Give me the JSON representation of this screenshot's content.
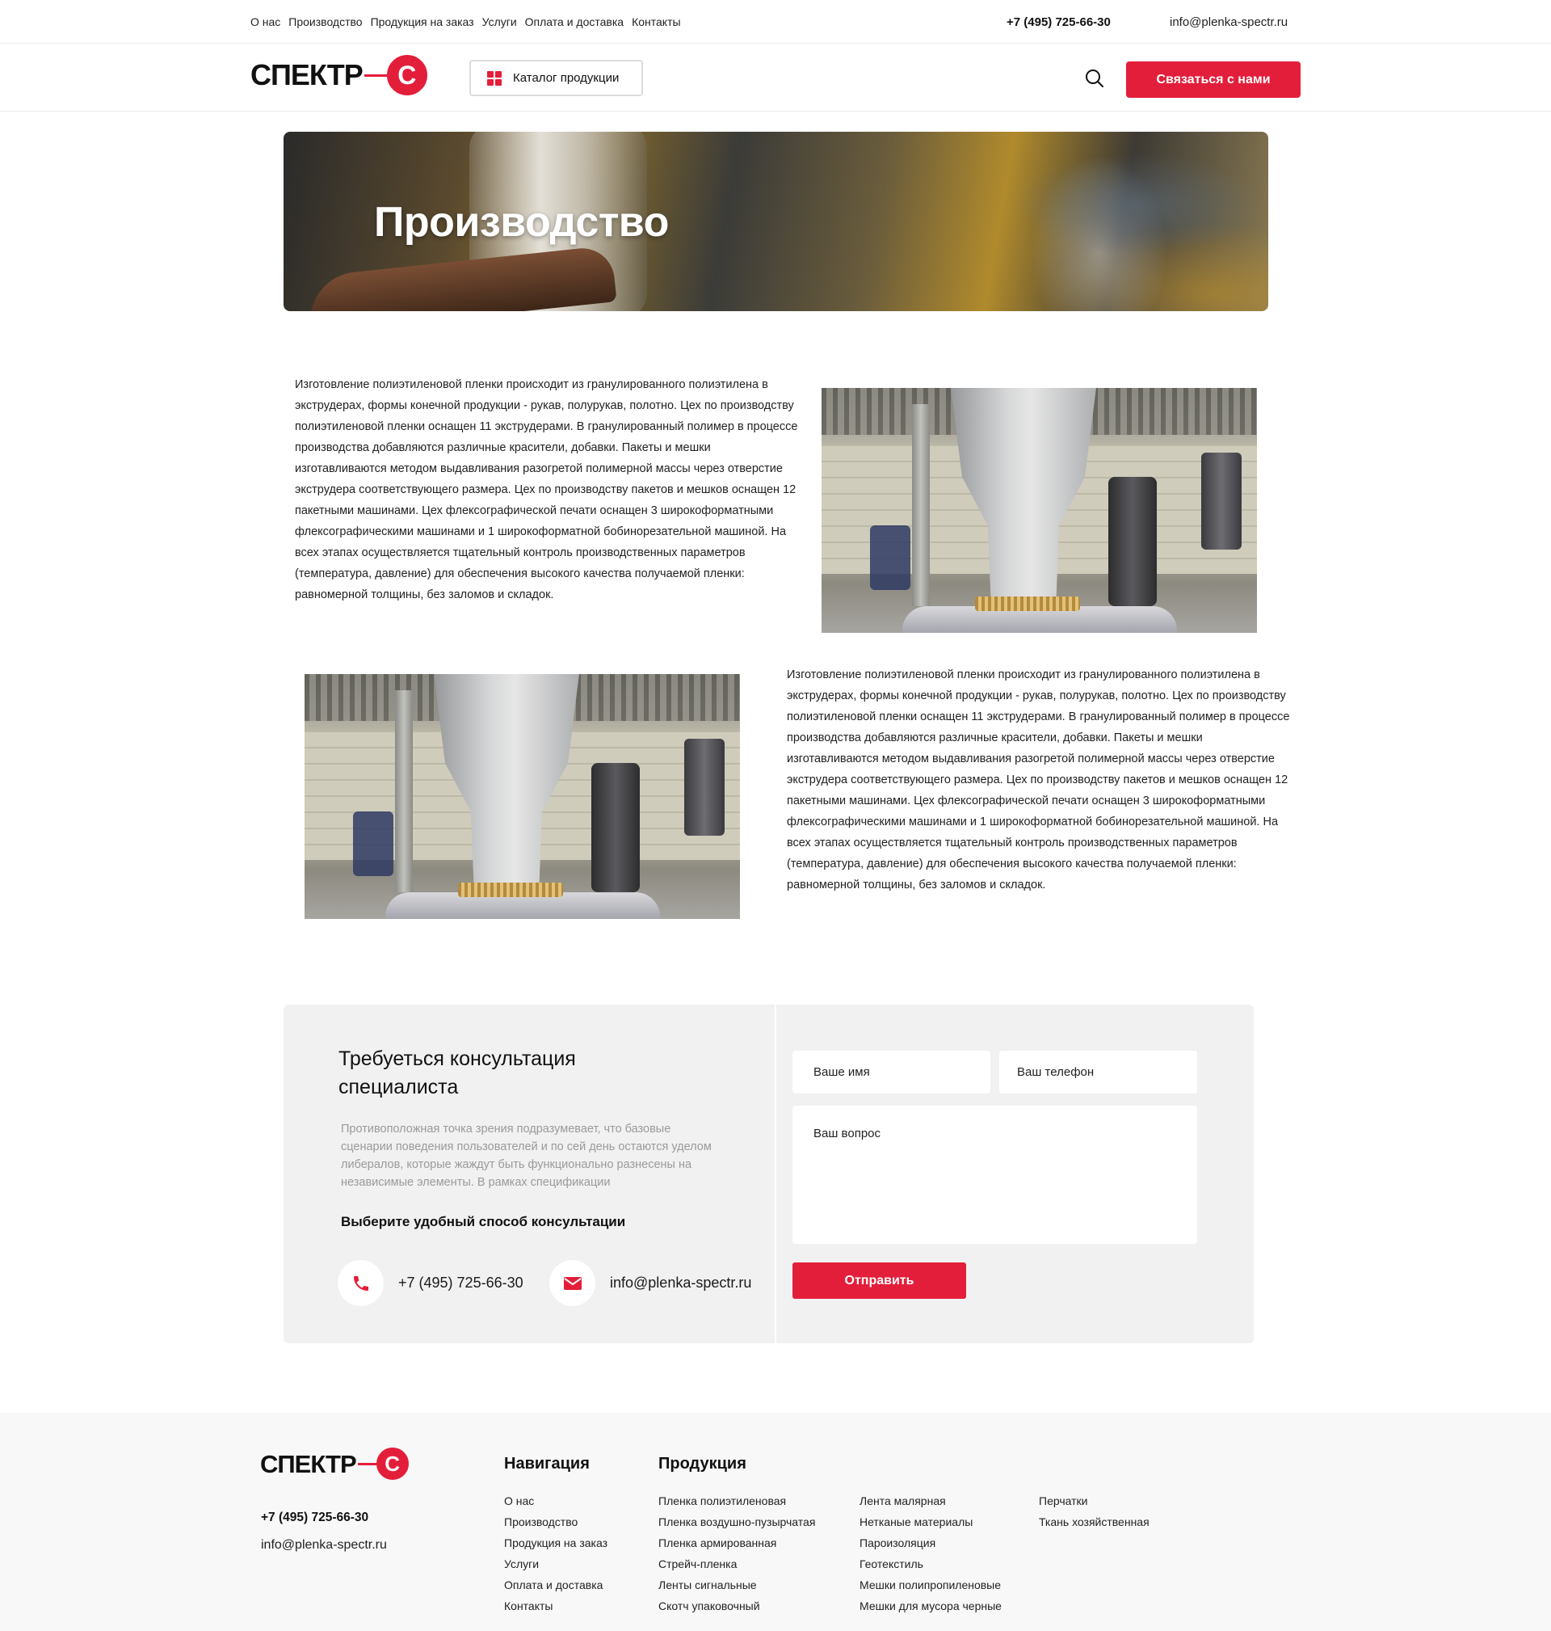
{
  "topbar": {
    "nav": [
      "О нас",
      "Производство",
      "Продукция на заказ",
      "Услуги",
      "Оплата и доставка",
      "Контакты"
    ],
    "phone": "+7 (495) 725-66-30",
    "email": "info@plenka-spectr.ru"
  },
  "header": {
    "logo_text": "СПЕКТР",
    "logo_letter": "С",
    "catalog_label": "Каталог продукции",
    "contact_button": "Связаться с нами",
    "accent_color": "#e31e3a"
  },
  "hero": {
    "title": "Производство"
  },
  "content": {
    "paragraph1": "Изготовление полиэтиленовой пленки происходит из гранулированного полиэтилена в экструдерах, формы конечной продукции - рукав, полурукав, полотно. Цех по производству полиэтиленовой пленки оснащен 11 экструдерами. В гранулированный полимер в процессе производства добавляются различные красители, добавки. Пакеты и мешки изготавливаются методом выдавливания разогретой полимерной массы через отверстие экструдера соответствующего размера. Цех по производству пакетов и мешков оснащен 12 пакетными машинами. Цех флексографической печати оснащен 3 широкоформатными флексографическими машинами и 1 широкоформатной бобинорезательной машиной. На всех этапах осуществляется тщательный контроль производственных параметров (температура, давление) для обеспечения высокого качества получаемой пленки: равномерной толщины, без заломов и складок.",
    "paragraph2": "Изготовление полиэтиленовой пленки происходит из гранулированного полиэтилена в экструдерах, формы конечной продукции - рукав, полурукав, полотно. Цех по производству полиэтиленовой пленки оснащен 11 экструдерами. В гранулированный полимер в процессе производства добавляются различные красители, добавки. Пакеты и мешки изготавливаются методом выдавливания разогретой полимерной массы через отверстие экструдера соответствующего размера. Цех по производству пакетов и мешков оснащен 12 пакетными машинами. Цех флексографической печати оснащен 3 широкоформатными флексографическими машинами и 1 широкоформатной бобинорезательной машиной. На всех этапах осуществляется тщательный контроль производственных параметров (температура, давление) для обеспечения высокого качества получаемой пленки: равномерной толщины, без заломов и складок."
  },
  "consult": {
    "title": "Требуеться консультация специалиста",
    "text": "Противоположная точка зрения подразумевает, что базовые сценарии поведения пользователей и по сей день остаются уделом либералов, которые жаждут быть функционально разнесены на независимые элементы. В рамках спецификации",
    "subtitle": "Выберите удобный способ консультации",
    "phone": "+7 (495) 725-66-30",
    "email": "info@plenka-spectr.ru",
    "form": {
      "name_placeholder": "Ваше имя",
      "phone_placeholder": "Ваш телефон",
      "question_placeholder": "Ваш вопрос",
      "submit_label": "Отправить"
    }
  },
  "footer": {
    "logo_text": "СПЕКТР",
    "logo_letter": "С",
    "phone": "+7 (495) 725-66-30",
    "email": "info@plenka-spectr.ru",
    "nav_heading": "Навигация",
    "nav_items": [
      "О нас",
      "Производство",
      "Продукция на заказ",
      "Услуги",
      "Оплата и доставка",
      "Контакты"
    ],
    "products_heading": "Продукция",
    "products_col1": [
      "Пленка полиэтиленовая",
      "Пленка воздушно-пузырчатая",
      "Пленка армированная",
      "Стрейч-пленка",
      "Ленты сигнальные",
      "Скотч упаковочный"
    ],
    "products_col2": [
      "Лента малярная",
      "Нетканые материалы",
      "Пароизоляция",
      "Геотекстиль",
      "Мешки полипропиленовые",
      "Мешки для мусора черные"
    ],
    "products_col3": [
      "Перчатки",
      "Ткань хозяйственная"
    ]
  }
}
